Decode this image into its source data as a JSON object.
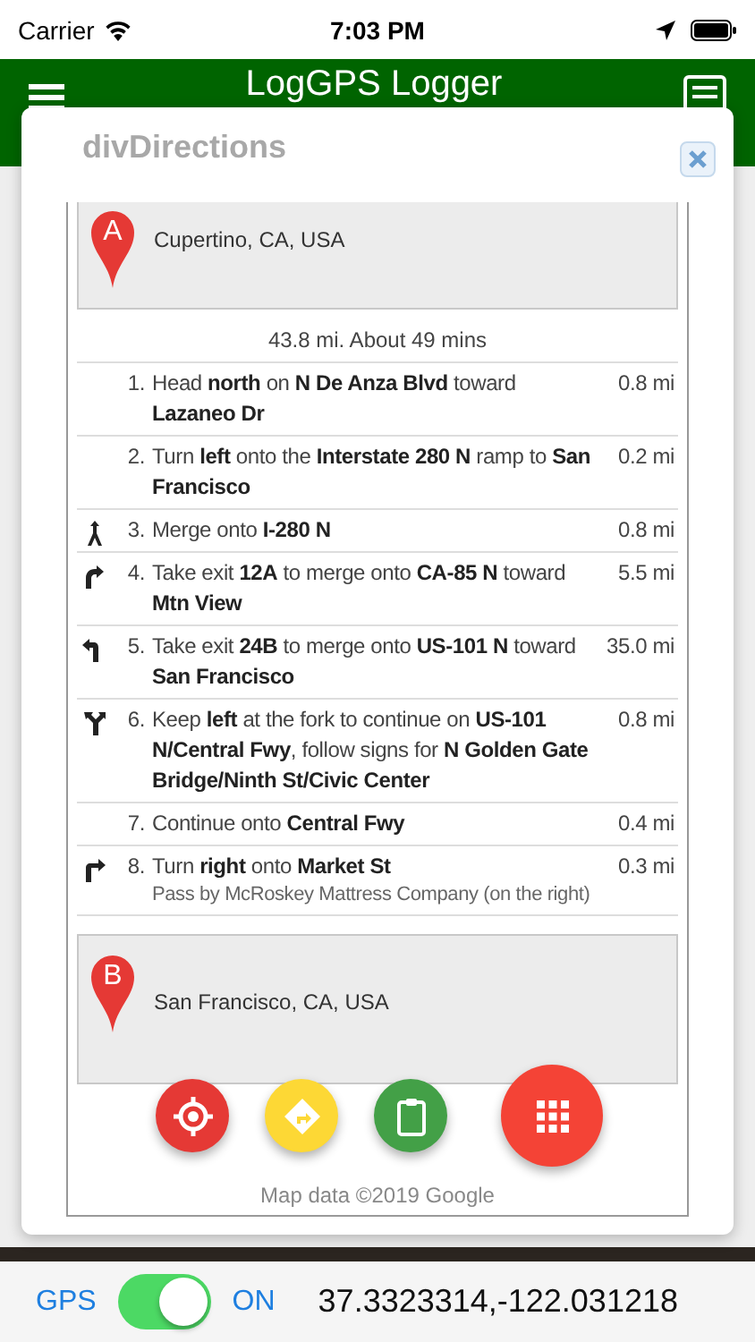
{
  "status_bar": {
    "carrier": "Carrier",
    "time": "7:03 PM"
  },
  "app_bar": {
    "title": "LogGPS Logger"
  },
  "dialog": {
    "title": "divDirections",
    "start": {
      "marker": "A",
      "address": "Cupertino, CA, USA"
    },
    "summary": "43.8 mi. About 49 mins",
    "steps": [
      {
        "kind": "none",
        "number": "1.",
        "text": "Head **north** on **N De Anza Blvd** toward **Lazaneo Dr**",
        "distance": "0.8 mi"
      },
      {
        "kind": "none",
        "number": "2.",
        "text": "Turn **left** onto the **Interstate 280 N** ramp to **San Francisco**",
        "distance": "0.2 mi"
      },
      {
        "kind": "merge",
        "number": "3.",
        "text": "Merge onto **I-280 N**",
        "distance": "0.8 mi"
      },
      {
        "kind": "ramp-right",
        "number": "4.",
        "text": "Take exit **12A** to merge onto **CA-85 N** toward **Mtn View**",
        "distance": "5.5 mi"
      },
      {
        "kind": "ramp-left",
        "number": "5.",
        "text": "Take exit **24B** to merge onto **US-101 N** toward **San Francisco**",
        "distance": "35.0 mi"
      },
      {
        "kind": "fork-left",
        "number": "6.",
        "text": "Keep **left** at the fork to continue on **US-101 N/Central Fwy**, follow signs for **N Golden Gate Bridge/Ninth St/Civic Center**",
        "distance": "0.8 mi"
      },
      {
        "kind": "none",
        "number": "7.",
        "text": "Continue onto **Central Fwy**",
        "distance": "0.4 mi"
      },
      {
        "kind": "turn-right",
        "number": "8.",
        "text": "Turn **right** onto **Market St**",
        "note": "Pass by McRoskey Mattress Company (on the right)",
        "distance": "0.3 mi"
      }
    ],
    "end": {
      "marker": "B",
      "address": "San Francisco, CA, USA"
    },
    "copyright": "Map data ©2019 Google"
  },
  "fab_buttons": [
    {
      "kind": "locate",
      "color": "#e53935"
    },
    {
      "kind": "directions",
      "color": "#fdd835"
    },
    {
      "kind": "clipboard",
      "color": "#43a047"
    },
    {
      "kind": "apps",
      "color": "#f44336"
    }
  ],
  "gps_bar": {
    "label": "GPS",
    "on": true,
    "state_text": "ON",
    "coordinates": "37.3323314,-122.031218"
  }
}
